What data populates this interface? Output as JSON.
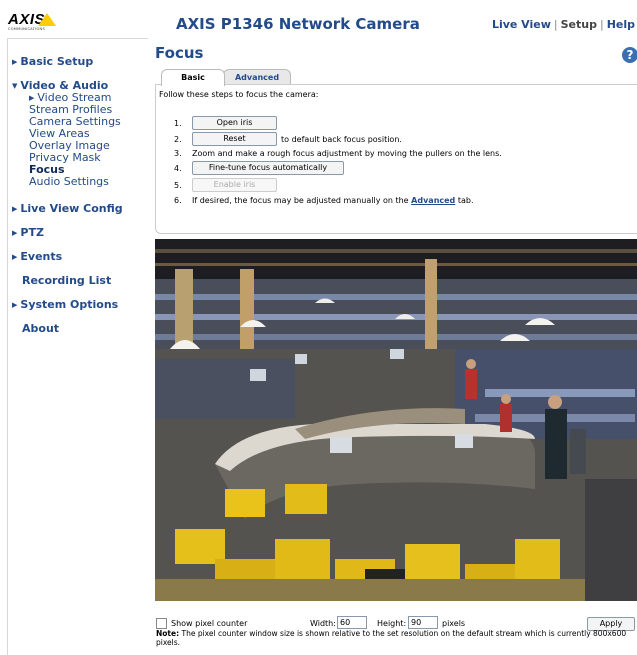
{
  "brand": {
    "logo_text": "AXIS",
    "logo_subtext": "COMMUNICATIONS"
  },
  "header": {
    "title": "AXIS P1346 Network Camera",
    "links": {
      "live_view": "Live View",
      "separator": "|",
      "setup": "Setup",
      "help": "Help"
    }
  },
  "sidebar": {
    "basic_setup": "Basic Setup",
    "video_audio": "Video & Audio",
    "video_audio_items": [
      "Video Stream",
      "Stream Profiles",
      "Camera Settings",
      "View Areas",
      "Overlay Image",
      "Privacy Mask",
      "Focus",
      "Audio Settings"
    ],
    "live_view_config": "Live View Config",
    "ptz": "PTZ",
    "events": "Events",
    "recording_list": "Recording List",
    "system_options": "System Options",
    "about": "About"
  },
  "main": {
    "title": "Focus",
    "help_icon": "?",
    "tabs": [
      "Basic",
      "Advanced"
    ],
    "intro": "Follow these steps to focus the camera:",
    "steps": [
      {
        "num": "1.",
        "button": "Open iris"
      },
      {
        "num": "2.",
        "button": "Reset",
        "text": "to default back focus position."
      },
      {
        "num": "3.",
        "text": "Zoom and make a rough focus adjustment by moving the pullers on the lens."
      },
      {
        "num": "4.",
        "button": "Fine-tune focus automatically"
      },
      {
        "num": "5.",
        "button": "Enable iris"
      },
      {
        "num": "6.",
        "text_before": "If desired, the focus may be adjusted manually on the",
        "link": "Advanced",
        "text_after": "tab."
      }
    ]
  },
  "pixel_counter": {
    "checkbox_label": "Show pixel counter",
    "width_label": "Width:",
    "width_value": "60",
    "height_label": "Height:",
    "height_value": "90",
    "unit": "pixels",
    "apply_label": "Apply",
    "note_label": "Note:",
    "note_text": "The pixel counter window size is shown relative to the set resolution on the default stream which is currently 800x600 pixels."
  },
  "colors": {
    "accent": "#234b8a",
    "logo_yellow": "#ffcc00"
  }
}
